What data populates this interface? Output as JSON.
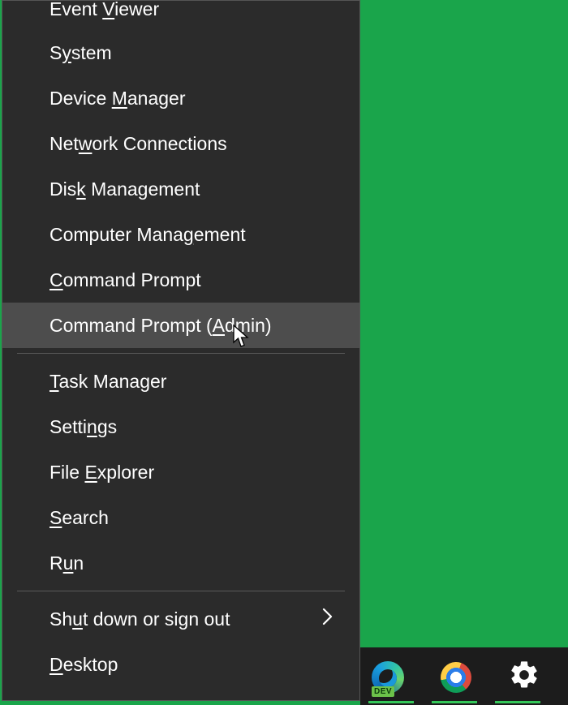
{
  "menu": {
    "groups": [
      [
        {
          "pre": "Event ",
          "key": "V",
          "post": "iewer"
        },
        {
          "pre": "S",
          "key": "y",
          "post": "stem"
        },
        {
          "pre": "Device ",
          "key": "M",
          "post": "anager"
        },
        {
          "pre": "Net",
          "key": "w",
          "post": "ork Connections"
        },
        {
          "pre": "Dis",
          "key": "k",
          "post": " Management"
        },
        {
          "pre": "Computer Mana",
          "key": "g",
          "post": "ement"
        },
        {
          "pre": "",
          "key": "C",
          "post": "ommand Prompt"
        },
        {
          "pre": "Command Prompt (",
          "key": "A",
          "post": "dmin)",
          "hover": true
        }
      ],
      [
        {
          "pre": "",
          "key": "T",
          "post": "ask Manager"
        },
        {
          "pre": "Setti",
          "key": "n",
          "post": "gs"
        },
        {
          "pre": "File ",
          "key": "E",
          "post": "xplorer"
        },
        {
          "pre": "",
          "key": "S",
          "post": "earch"
        },
        {
          "pre": "R",
          "key": "u",
          "post": "n"
        }
      ],
      [
        {
          "pre": "Sh",
          "key": "u",
          "post": "t down or sign out",
          "submenu": true
        },
        {
          "pre": "",
          "key": "D",
          "post": "esktop"
        }
      ]
    ]
  },
  "taskbar": {
    "items": [
      {
        "name": "edge-dev",
        "badge": "DEV",
        "running": true
      },
      {
        "name": "chrome",
        "running": true
      },
      {
        "name": "settings",
        "running": true
      }
    ]
  }
}
